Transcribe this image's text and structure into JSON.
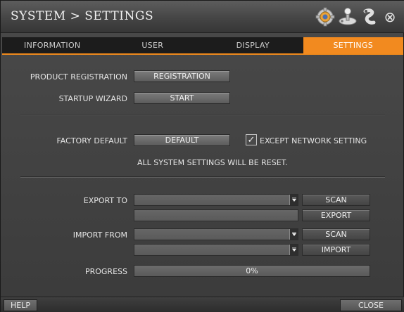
{
  "window": {
    "title": "SYSTEM > SETTINGS",
    "icons": [
      "gear-icon",
      "joystick-icon",
      "snake-icon",
      "close-icon"
    ],
    "close_glyph": "⊗"
  },
  "tabs": [
    {
      "label": "INFORMATION",
      "active": false
    },
    {
      "label": "USER",
      "active": false
    },
    {
      "label": "DISPLAY",
      "active": false
    },
    {
      "label": "SETTINGS",
      "active": true
    }
  ],
  "registration": {
    "label": "PRODUCT REGISTRATION",
    "button": "REGISTRATION"
  },
  "startup": {
    "label": "STARTUP WIZARD",
    "button": "START"
  },
  "factory": {
    "label": "FACTORY DEFAULT",
    "button": "DEFAULT",
    "checkbox_label": "EXCEPT NETWORK SETTING",
    "checkbox_checked": true,
    "warning": "ALL SYSTEM SETTINGS WILL BE RESET."
  },
  "export": {
    "label": "EXPORT TO",
    "device_value": "",
    "file_value": "",
    "scan_button": "SCAN",
    "export_button": "EXPORT"
  },
  "import": {
    "label": "IMPORT FROM",
    "device_value": "",
    "file_value": "",
    "scan_button": "SCAN",
    "import_button": "IMPORT"
  },
  "progress": {
    "label": "PROGRESS",
    "value": 0,
    "text": "0%"
  },
  "footer": {
    "help": "HELP",
    "close": "CLOSE"
  },
  "colors": {
    "accent": "#f28a1f",
    "background": "#434343",
    "tab_bar": "#1c1c1c"
  }
}
